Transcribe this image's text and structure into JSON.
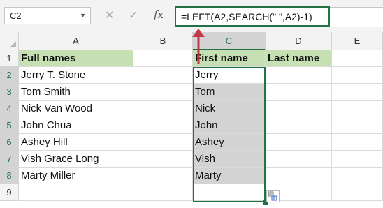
{
  "formula_bar": {
    "name_box": "C2",
    "cancel_icon": "✕",
    "enter_icon": "✓",
    "fx_label": "fx",
    "formula": "=LEFT(A2,SEARCH(\" \",A2)-1)"
  },
  "columns": [
    "A",
    "B",
    "C",
    "D",
    "E"
  ],
  "rows": [
    "1",
    "2",
    "3",
    "4",
    "5",
    "6",
    "7",
    "8",
    "9"
  ],
  "cells": {
    "A": [
      "Full names",
      "Jerry T. Stone",
      "Tom Smith",
      "Nick Van Wood",
      "John Chua",
      "Ashey Hill",
      "Vish Grace Long",
      "Marty Miller"
    ],
    "C": [
      "First name",
      "Jerry",
      "Tom",
      "Nick",
      "John",
      "Ashey",
      "Vish",
      "Marty"
    ],
    "D": [
      "Last name"
    ]
  },
  "selected_range": "C2:C8",
  "colors": {
    "header_fill": "#c6e0b4",
    "selection_fill": "#d3d3d3",
    "accent": "#217346",
    "arrow": "#c0394b"
  },
  "icons": {
    "arrow": "up-arrow-icon",
    "autofill": "auto-fill-options-icon"
  }
}
